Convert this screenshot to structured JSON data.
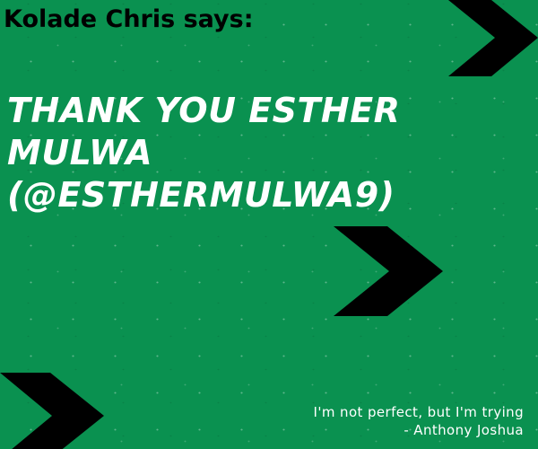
{
  "card": {
    "speaker": "Kolade Chris says:",
    "headline_lines": [
      "THANK YOU ESTHER",
      "MULWA",
      "(@ESTHERMULWA9)"
    ],
    "quote_text": "I'm not perfect, but I'm trying",
    "quote_author": "- Anthony Joshua"
  },
  "colors": {
    "background": "#0a9150",
    "chevron": "#000000",
    "header_text": "#000000",
    "headline_text": "#ffffff",
    "quote_text": "#ffffff"
  },
  "decorations": [
    "chevron-arrow-icon",
    "chevron-arrow-icon",
    "chevron-arrow-icon"
  ]
}
